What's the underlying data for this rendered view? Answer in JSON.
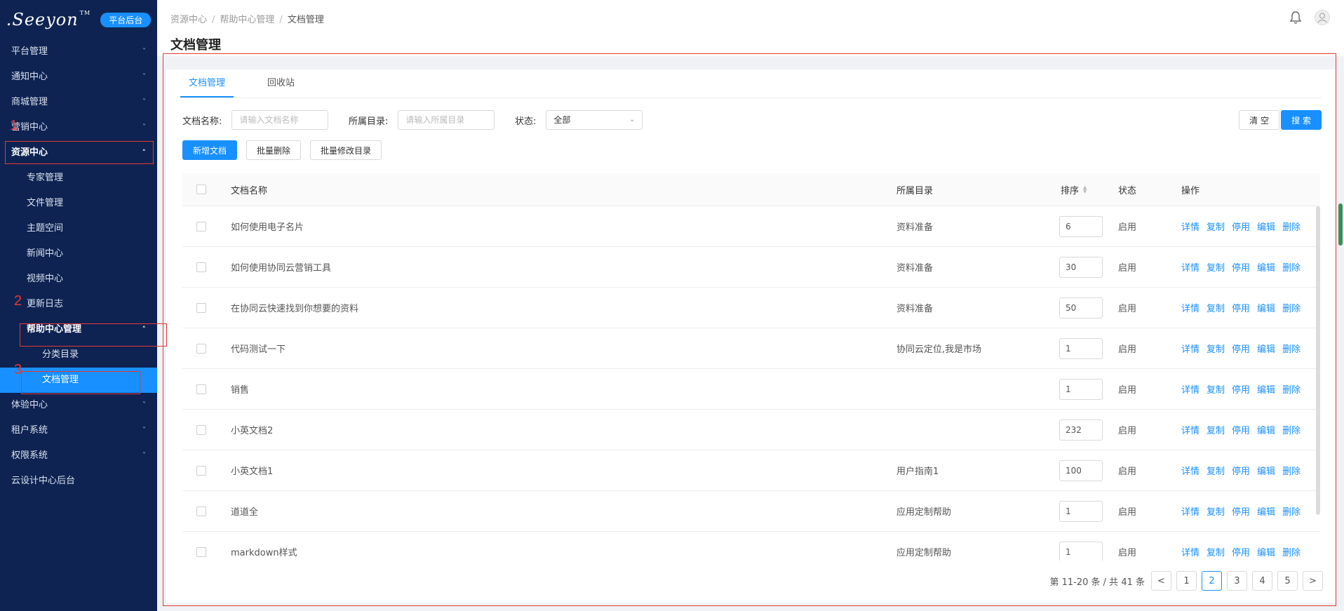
{
  "logo": {
    "text": ".Seeyon",
    "tm": "TM",
    "badge": "平台后台"
  },
  "sidebar": {
    "items": [
      {
        "label": "平台管理",
        "level": 1,
        "chevron": "down"
      },
      {
        "label": "通知中心",
        "level": 1,
        "chevron": "down"
      },
      {
        "label": "商城管理",
        "level": 1,
        "chevron": "down"
      },
      {
        "label": "营销中心",
        "level": 1,
        "chevron": "down"
      },
      {
        "label": "资源中心",
        "level": 1,
        "chevron": "up",
        "bold": true
      },
      {
        "label": "专家管理",
        "level": 2
      },
      {
        "label": "文件管理",
        "level": 2
      },
      {
        "label": "主题空间",
        "level": 2
      },
      {
        "label": "新闻中心",
        "level": 2
      },
      {
        "label": "视频中心",
        "level": 2
      },
      {
        "label": "更新日志",
        "level": 2
      },
      {
        "label": "帮助中心管理",
        "level": 2,
        "chevron": "up",
        "bold": true
      },
      {
        "label": "分类目录",
        "level": 3
      },
      {
        "label": "文档管理",
        "level": 3,
        "active": true
      },
      {
        "label": "体验中心",
        "level": 1,
        "chevron": "down"
      },
      {
        "label": "租户系统",
        "level": 1,
        "chevron": "down"
      },
      {
        "label": "权限系统",
        "level": 1,
        "chevron": "down"
      },
      {
        "label": "云设计中心后台",
        "level": 1
      }
    ]
  },
  "header": {
    "breadcrumb": [
      "资源中心",
      "帮助中心管理",
      "文档管理"
    ],
    "separator": "/",
    "title": "文档管理"
  },
  "tabs": [
    {
      "label": "文档管理",
      "active": true
    },
    {
      "label": "回收站",
      "active": false
    }
  ],
  "filters": {
    "name_label": "文档名称:",
    "name_placeholder": "请输入文档名称",
    "dir_label": "所属目录:",
    "dir_placeholder": "请输入所属目录",
    "status_label": "状态:",
    "status_value": "全部",
    "clear_label": "清 空",
    "search_label": "搜 索"
  },
  "actions": {
    "add_label": "新增文档",
    "batch_delete_label": "批量删除",
    "batch_dir_label": "批量修改目录"
  },
  "table": {
    "columns": {
      "name": "文档名称",
      "dir": "所属目录",
      "sort": "排序",
      "status": "状态",
      "ops": "操作"
    },
    "op_labels": [
      "详情",
      "复制",
      "停用",
      "编辑",
      "删除"
    ],
    "rows": [
      {
        "name": "如何使用电子名片",
        "dir": "资料准备",
        "sort": "6",
        "status": "启用"
      },
      {
        "name": "如何使用协同云营销工具",
        "dir": "资料准备",
        "sort": "30",
        "status": "启用"
      },
      {
        "name": "在协同云快速找到你想要的资料",
        "dir": "资料准备",
        "sort": "50",
        "status": "启用"
      },
      {
        "name": "代码测试一下",
        "dir": "协同云定位,我是市场",
        "sort": "1",
        "status": "启用"
      },
      {
        "name": "销售",
        "dir": "",
        "sort": "1",
        "status": "启用"
      },
      {
        "name": "小英文档2",
        "dir": "",
        "sort": "232",
        "status": "启用"
      },
      {
        "name": "小英文档1",
        "dir": "用户指南1",
        "sort": "100",
        "status": "启用"
      },
      {
        "name": "道道全",
        "dir": "应用定制帮助",
        "sort": "1",
        "status": "启用"
      },
      {
        "name": "markdown样式",
        "dir": "应用定制帮助",
        "sort": "1",
        "status": "启用"
      }
    ]
  },
  "pagination": {
    "summary": "第 11-20 条 / 共 41 条",
    "pages": [
      "1",
      "2",
      "3",
      "4",
      "5"
    ],
    "current": "2",
    "prev": "<",
    "next": ">"
  },
  "annotations": [
    "1",
    "2",
    "3"
  ],
  "colors": {
    "sidebar_bg": "#0e2352",
    "accent": "#1890ff",
    "annotation": "#e53935"
  }
}
